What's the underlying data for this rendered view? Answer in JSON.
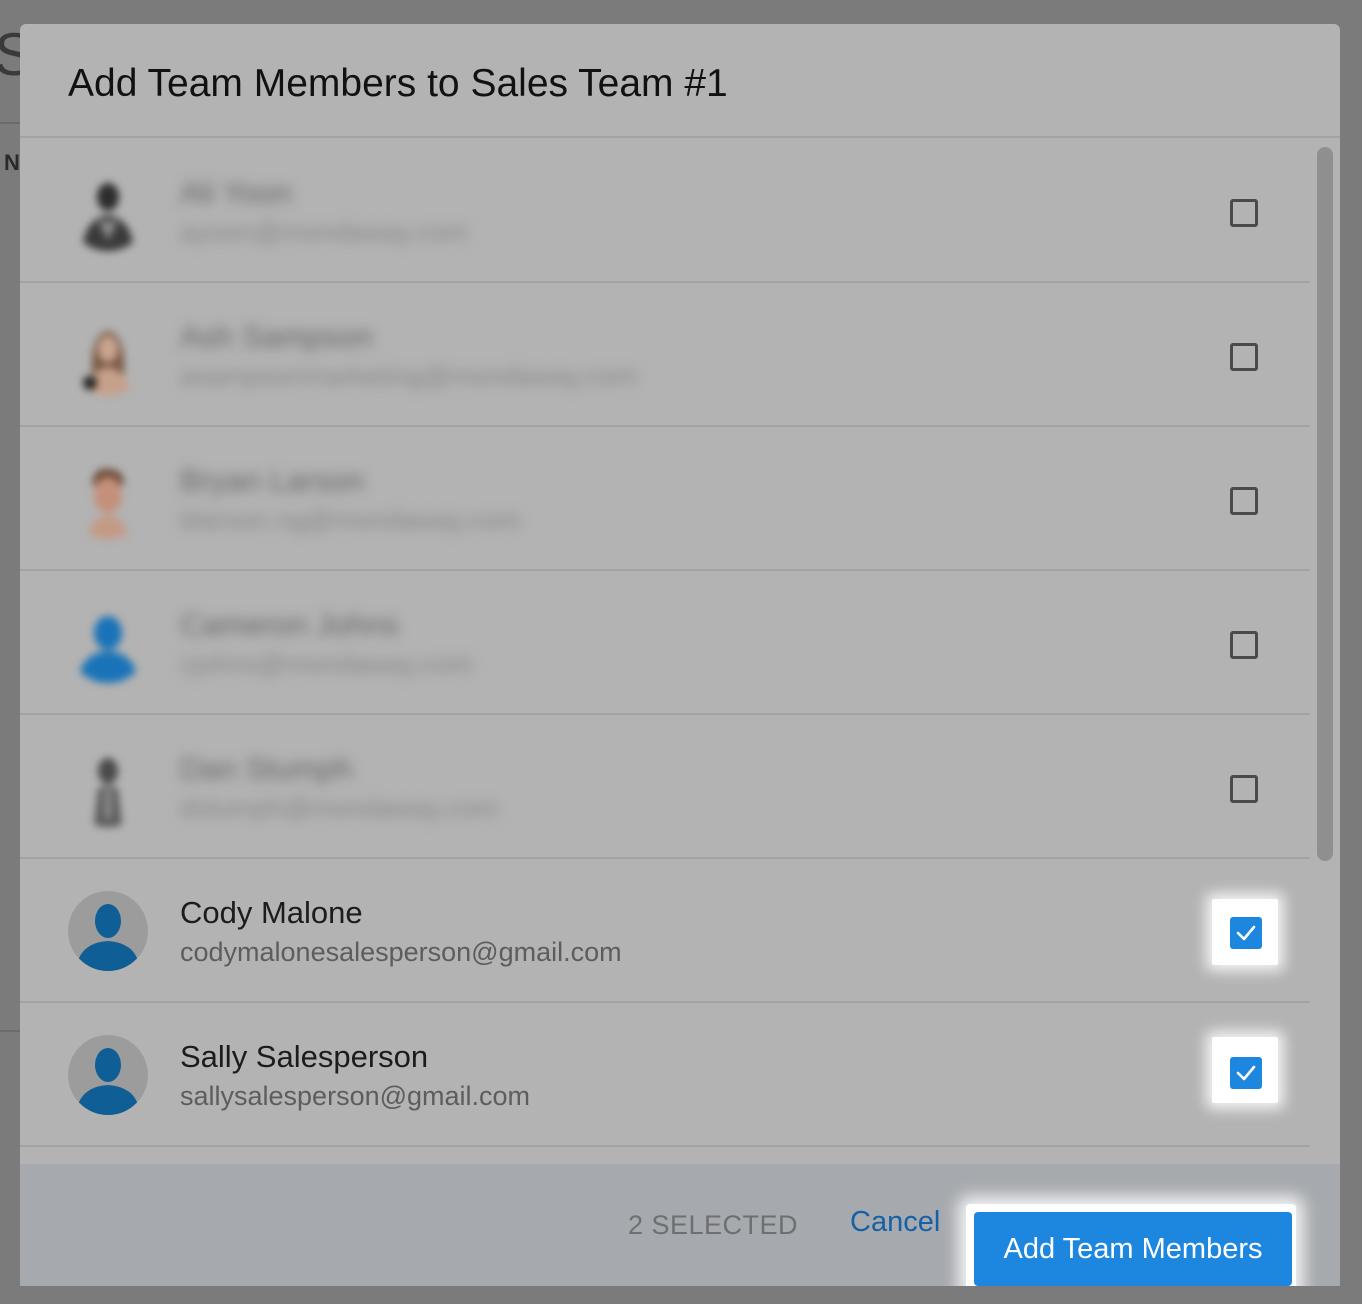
{
  "modal": {
    "title": "Add Team Members to Sales Team #1"
  },
  "members": [
    {
      "name": "Ali Yoon",
      "email": "ayoon@mondaway.com",
      "checked": false,
      "avatar": "photo-avatar-icon",
      "blurred": true
    },
    {
      "name": "Ash Sampson",
      "email": "asampsonmarketing@mondaway.com",
      "checked": false,
      "avatar": "photo-avatar-icon",
      "blurred": true
    },
    {
      "name": "Bryan Larson",
      "email": "blarson.ng@mondaway.com",
      "checked": false,
      "avatar": "photo-avatar-icon",
      "blurred": true
    },
    {
      "name": "Cameron Johns",
      "email": "cjohns@mondaway.com",
      "checked": false,
      "avatar": "default-user-avatar-icon",
      "blurred": true
    },
    {
      "name": "Dan Stumph",
      "email": "dstumph@mondaway.com",
      "checked": false,
      "avatar": "photo-avatar-icon",
      "blurred": true
    },
    {
      "name": "Cody Malone",
      "email": "codymalonesalesperson@gmail.com",
      "checked": true,
      "avatar": "default-user-avatar-icon",
      "blurred": false
    },
    {
      "name": "Sally Salesperson",
      "email": "sallysalesperson@gmail.com",
      "checked": true,
      "avatar": "default-user-avatar-icon",
      "blurred": false
    }
  ],
  "footer": {
    "selected_text": "2 SELECTED",
    "cancel_label": "Cancel",
    "add_label": "Add Team Members"
  },
  "colors": {
    "accent": "#1d87df",
    "link": "#1361a6",
    "avatar_blue": "#0f5f96"
  }
}
